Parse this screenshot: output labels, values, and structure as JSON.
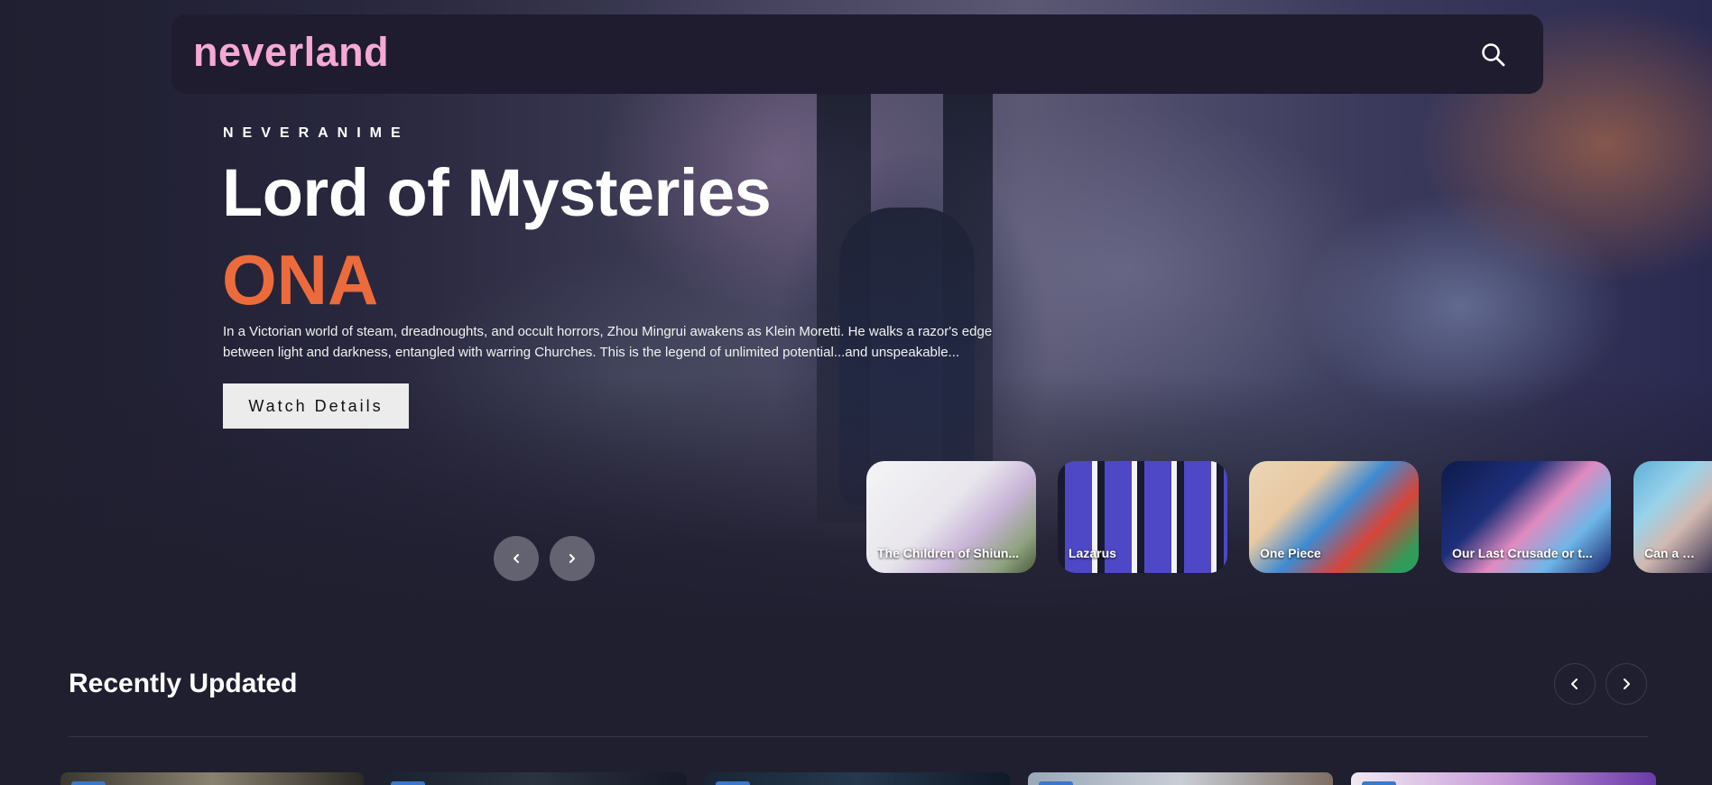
{
  "navbar": {
    "logo": "neverland",
    "search_icon": "search-icon"
  },
  "hero": {
    "brand": "NEVERANIME",
    "title": "Lord of Mysteries",
    "type": "ONA",
    "description": "In a Victorian world of steam, dreadnoughts, and occult horrors, Zhou Mingrui awakens as Klein Moretti. He walks a razor's edge between light and darkness, entangled with warring Churches. This is the legend of unlimited potential...and unspeakable...",
    "watch_button": "Watch Details",
    "prev_icon": "chevron-left-icon",
    "next_icon": "chevron-right-icon",
    "colors": {
      "accent": "#ec6b3c",
      "logo": "#f5a9d4"
    }
  },
  "carousel": {
    "items": [
      {
        "label": "The Children of Shiun..."
      },
      {
        "label": "Lazarus"
      },
      {
        "label": "One Piece"
      },
      {
        "label": "Our Last Crusade or t..."
      },
      {
        "label": "Can a Boy a..."
      }
    ]
  },
  "recently_updated": {
    "title": "Recently Updated",
    "prev_icon": "chevron-left-icon",
    "next_icon": "chevron-right-icon"
  }
}
